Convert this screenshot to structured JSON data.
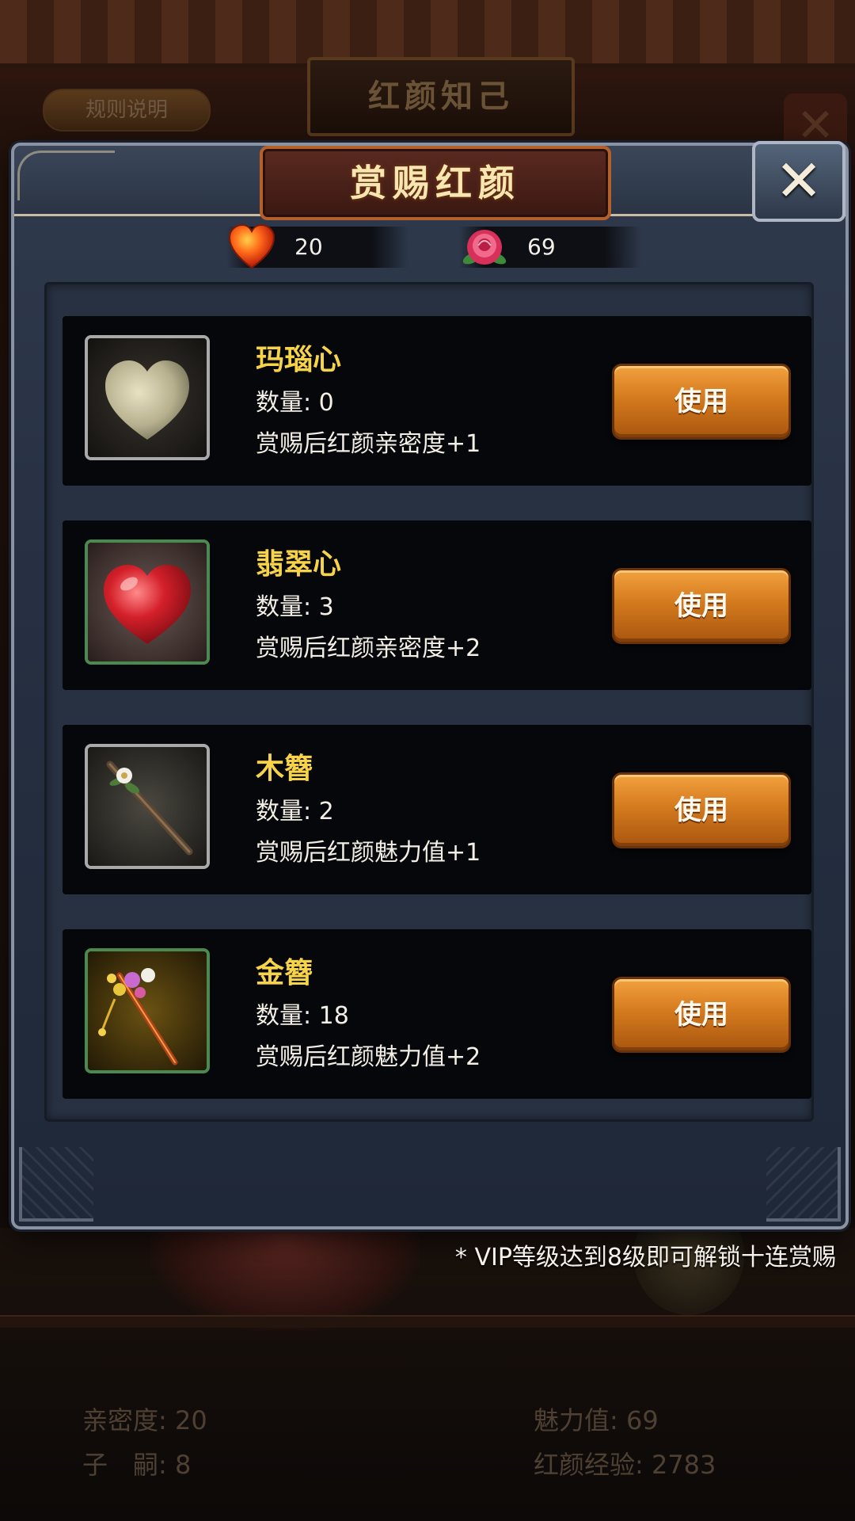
{
  "background": {
    "screen_title": "红颜知己",
    "rules_button": "规则说明",
    "close_glyph": "✕",
    "stats": {
      "intimacy": "亲密度: 20",
      "charm": "魅力值: 69",
      "children": "子　嗣: 8",
      "experience": "红颜经验: 2783"
    }
  },
  "modal": {
    "title": "赏赐红颜",
    "close_glyph": "✕",
    "resources": {
      "hearts": "20",
      "roses": "69"
    },
    "items": [
      {
        "name": "玛瑙心",
        "quantity": "数量: 0",
        "effect": "赏赐后红颜亲密度+1",
        "button": "使用",
        "frame": "gray",
        "icon": "agate-heart-icon"
      },
      {
        "name": "翡翠心",
        "quantity": "数量: 3",
        "effect": "赏赐后红颜亲密度+2",
        "button": "使用",
        "frame": "green",
        "icon": "red-heart-icon"
      },
      {
        "name": "木簪",
        "quantity": "数量: 2",
        "effect": "赏赐后红颜魅力值+1",
        "button": "使用",
        "frame": "gray",
        "icon": "wooden-hairpin-icon"
      },
      {
        "name": "金簪",
        "quantity": "数量: 18",
        "effect": "赏赐后红颜魅力值+2",
        "button": "使用",
        "frame": "green",
        "icon": "golden-hairpin-icon"
      }
    ],
    "footnote": "* VIP等级达到8级即可解锁十连赏赐"
  },
  "colors": {
    "item_name": "#f7d34a",
    "button": "#d47a1e",
    "modal_bg": "#263042"
  }
}
